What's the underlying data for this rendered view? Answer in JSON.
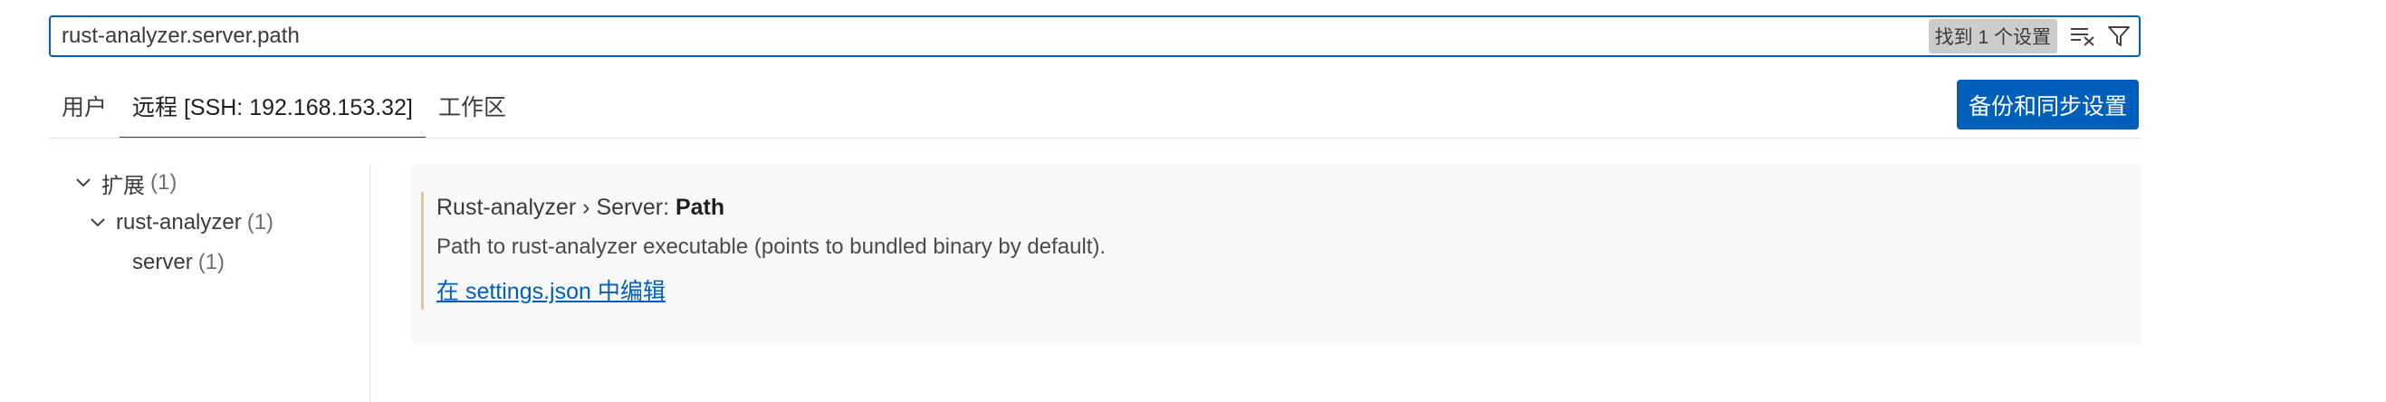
{
  "search": {
    "value": "rust-analyzer.server.path",
    "result_count": "找到 1 个设置",
    "clear_filter_icon": "clear-filter-icon",
    "filter_icon": "filter-icon"
  },
  "tabs": [
    {
      "label": "用户",
      "active": false
    },
    {
      "label": "远程 [SSH: 192.168.153.32]",
      "active": true
    },
    {
      "label": "工作区",
      "active": false
    }
  ],
  "sync_button": {
    "label": "备份和同步设置"
  },
  "toc": {
    "items": [
      {
        "label": "扩展",
        "count": "(1)",
        "expanded": true,
        "level": 0
      },
      {
        "label": "rust-analyzer",
        "count": "(1)",
        "expanded": true,
        "level": 1
      },
      {
        "label": "server",
        "count": "(1)",
        "expanded": false,
        "level": 2
      }
    ]
  },
  "setting": {
    "category": "Rust-analyzer › Server: ",
    "name": "Path",
    "description": "Path to rust-analyzer executable (points to bundled binary by default).",
    "edit_link": "在 settings.json 中编辑"
  },
  "colors": {
    "accent": "#005fb8",
    "modified_bar": "#e7c68a",
    "badge_bg": "#cccccc"
  }
}
